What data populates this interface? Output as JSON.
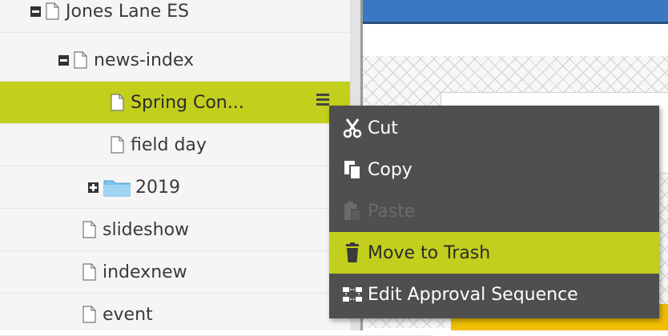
{
  "tree": {
    "items": [
      {
        "label": "Jones Lane ES",
        "type": "page",
        "toggle": "minus"
      },
      {
        "label": "news-index",
        "type": "page",
        "toggle": "minus"
      },
      {
        "label": "Spring Con...",
        "type": "page",
        "selected": true
      },
      {
        "label": "field day",
        "type": "page"
      },
      {
        "label": "2019",
        "type": "folder",
        "toggle": "plus"
      },
      {
        "label": "slideshow",
        "type": "page"
      },
      {
        "label": "indexnew",
        "type": "page"
      },
      {
        "label": "event",
        "type": "page"
      }
    ]
  },
  "context_menu": {
    "items": [
      {
        "label": "Cut",
        "icon": "scissors-icon",
        "enabled": true
      },
      {
        "label": "Copy",
        "icon": "copy-icon",
        "enabled": true
      },
      {
        "label": "Paste",
        "icon": "paste-icon",
        "enabled": false
      },
      {
        "label": "Move to Trash",
        "icon": "trash-icon",
        "enabled": true,
        "highlighted": true
      },
      {
        "label": "Edit Approval Sequence",
        "icon": "approval-sequence-icon",
        "enabled": true
      }
    ]
  },
  "colors": {
    "selection": "#c2cf1d",
    "menu_bg": "#4f4f4f",
    "topbar": "#3a78c4"
  }
}
